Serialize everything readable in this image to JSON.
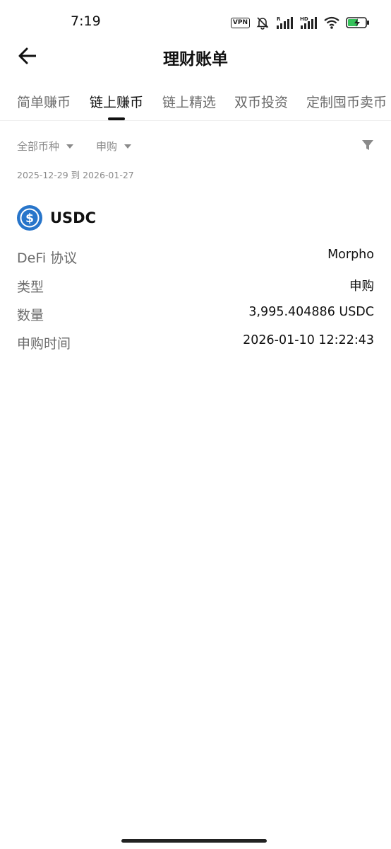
{
  "status_bar": {
    "time": "7:19",
    "vpn": "VPN",
    "icons": [
      "mute-bell-icon",
      "signal-r-icon",
      "signal-hd-icon",
      "wifi-icon",
      "battery-charging-icon"
    ]
  },
  "header": {
    "back_icon": "arrow-left-icon",
    "title": "理财账单"
  },
  "tabs": [
    {
      "label": "简单赚币",
      "active": false
    },
    {
      "label": "链上赚币",
      "active": true
    },
    {
      "label": "链上精选",
      "active": false
    },
    {
      "label": "双币投资",
      "active": false
    },
    {
      "label": "定制囤币卖币",
      "active": false
    }
  ],
  "filters": {
    "currency": "全部币种",
    "type": "申购",
    "filter_icon": "funnel-icon"
  },
  "date_range": "2025-12-29 到 2026-01-27",
  "record": {
    "coin": "USDC",
    "coin_icon": "usdc-logo-icon",
    "rows": [
      {
        "label": "DeFi 协议",
        "value": "Morpho"
      },
      {
        "label": "类型",
        "value": "申购"
      },
      {
        "label": "数量",
        "value": "3,995.404886 USDC"
      },
      {
        "label": "申购时间",
        "value": "2026-01-10 12:22:43"
      }
    ]
  },
  "colors": {
    "accent_usdc": "#2775CA",
    "text_primary": "#111111",
    "text_secondary": "#6b6b6b",
    "battery_green": "#35c25a"
  }
}
